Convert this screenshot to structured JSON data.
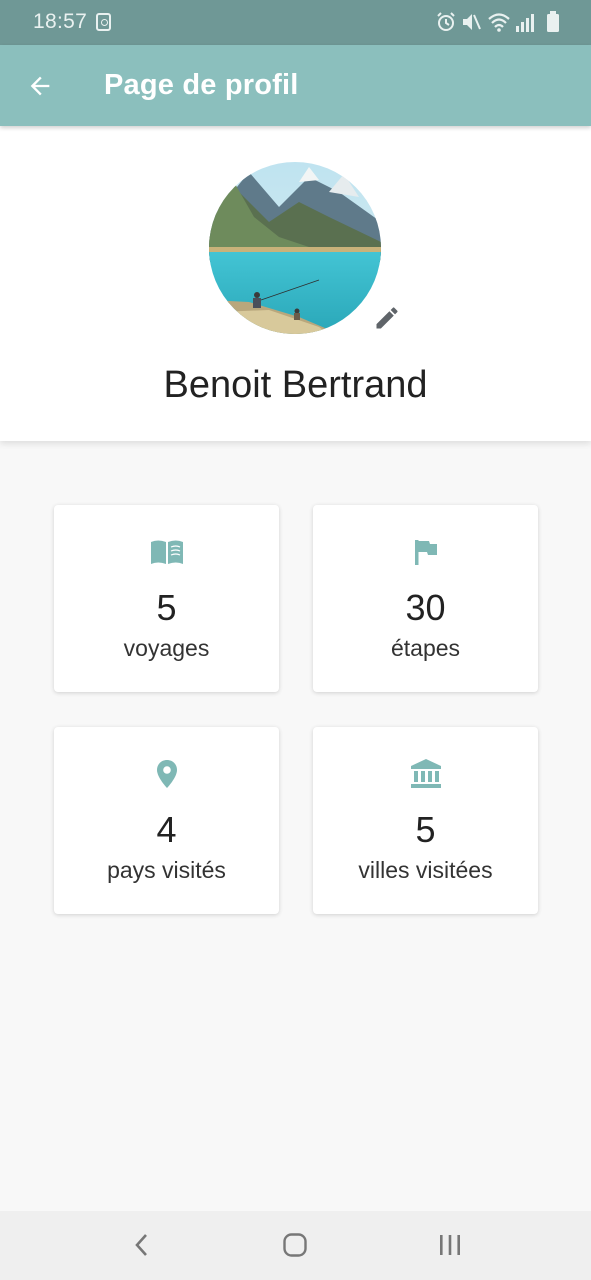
{
  "status_bar": {
    "time": "18:57",
    "icons": [
      "notification-icon",
      "alarm-icon",
      "mute-icon",
      "wifi-icon",
      "signal-icon",
      "battery-icon"
    ]
  },
  "app_bar": {
    "title": "Page de profil",
    "back_icon": "arrow-left-icon",
    "background": "#8bbfbd"
  },
  "profile": {
    "name": "Benoit Bertrand",
    "avatar_description": "mountain-lake-photo",
    "edit_icon": "pencil-icon"
  },
  "stats": [
    {
      "icon": "book-open-icon",
      "value": "5",
      "label": "voyages"
    },
    {
      "icon": "flag-icon",
      "value": "30",
      "label": "étapes"
    },
    {
      "icon": "map-pin-icon",
      "value": "4",
      "label": "pays visités"
    },
    {
      "icon": "bank-building-icon",
      "value": "5",
      "label": "villes visitées"
    }
  ],
  "colors": {
    "accent": "#7fb8b5",
    "status_bar": "#6f9896"
  },
  "nav_bar": {
    "buttons": [
      "back-nav-icon",
      "home-nav-icon",
      "recents-nav-icon"
    ]
  }
}
